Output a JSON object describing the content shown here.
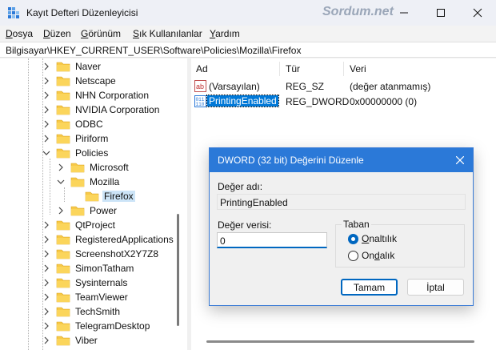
{
  "window": {
    "title": "Kayıt Defteri Düzenleyicisi",
    "watermark": "Sordum.net"
  },
  "menu": [
    {
      "accel": "D",
      "rest": "osya"
    },
    {
      "accel": "D",
      "rest": "üzen"
    },
    {
      "accel": "G",
      "rest": "örünüm"
    },
    {
      "accel": "S",
      "rest": "ık Kullanılanlar"
    },
    {
      "accel": "Y",
      "rest": "ardım"
    }
  ],
  "address": "Bilgisayar\\HKEY_CURRENT_USER\\Software\\Policies\\Mozilla\\Firefox",
  "tree": [
    {
      "label": "Naver"
    },
    {
      "label": "Netscape"
    },
    {
      "label": "NHN Corporation"
    },
    {
      "label": "NVIDIA Corporation"
    },
    {
      "label": "ODBC"
    },
    {
      "label": "Piriform"
    },
    {
      "label": "Policies"
    },
    {
      "label": "Microsoft"
    },
    {
      "label": "Mozilla"
    },
    {
      "label": "Firefox"
    },
    {
      "label": "Power"
    },
    {
      "label": "QtProject"
    },
    {
      "label": "RegisteredApplications"
    },
    {
      "label": "ScreenshotX2Y7Z8"
    },
    {
      "label": "SimonTatham"
    },
    {
      "label": "Sysinternals"
    },
    {
      "label": "TeamViewer"
    },
    {
      "label": "TechSmith"
    },
    {
      "label": "TelegramDesktop"
    },
    {
      "label": "Viber"
    }
  ],
  "list": {
    "columns": [
      "Ad",
      "Tür",
      "Veri"
    ],
    "rows": [
      {
        "name": "(Varsayılan)",
        "type": "REG_SZ",
        "data": "(değer atanmamış)",
        "icon": "string-value-icon"
      },
      {
        "name": "PrintingEnabled",
        "type": "REG_DWORD",
        "data": "0x00000000 (0)",
        "icon": "binary-value-icon"
      }
    ]
  },
  "dialog": {
    "title": "DWORD (32 bit) Değerini Düzenle",
    "name_label": "Değer adı:",
    "name_value": "PrintingEnabled",
    "data_label": "Değer verisi:",
    "data_value": "0",
    "base_label": "Taban",
    "hex_label": "Onaltılık",
    "dec_label": "Ondalık",
    "base_selected": "Onaltılık",
    "ok_label": "Tamam",
    "cancel_label": "İptal"
  },
  "colors": {
    "accent": "#2b79d8",
    "selection": "#0078d7",
    "folder": "#f7c948"
  }
}
